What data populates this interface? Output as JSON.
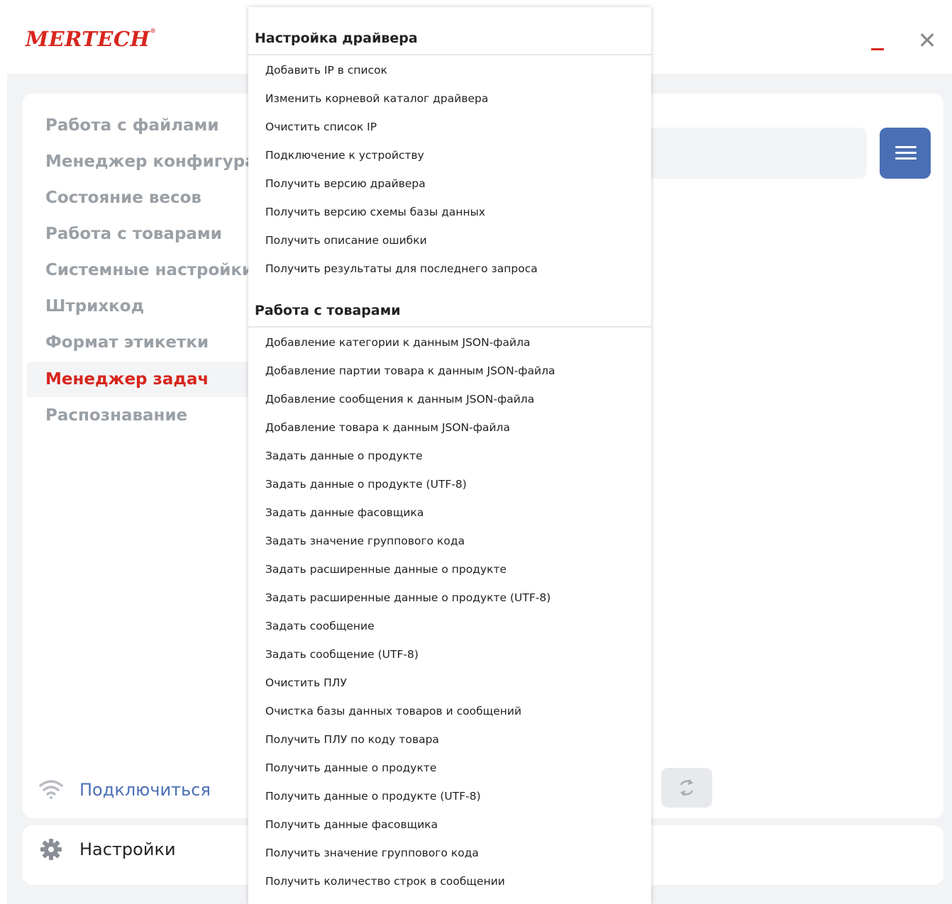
{
  "app": {
    "logo_text": "MERTECH",
    "logo_mark": "®",
    "close_glyph": "✕"
  },
  "nav": {
    "items": [
      {
        "label": "Работа с файлами",
        "active": false
      },
      {
        "label": "Менеджер конфигурации",
        "active": false
      },
      {
        "label": "Состояние весов",
        "active": false
      },
      {
        "label": "Работа с товарами",
        "active": false
      },
      {
        "label": "Системные настройки",
        "active": false
      },
      {
        "label": "Штрихкод",
        "active": false
      },
      {
        "label": "Формат этикетки",
        "active": false
      },
      {
        "label": "Менеджер задач",
        "active": true
      },
      {
        "label": "Распознавание",
        "active": false
      }
    ],
    "connect_label": "Подключиться",
    "settings_label": "Настройки"
  },
  "dropdown": {
    "sections": [
      {
        "title": "Настройка драйвера",
        "items": [
          "Добавить IP в список",
          "Изменить корневой каталог драйвера",
          "Очистить список IP",
          "Подключение к устройству",
          "Получить версию драйвера",
          "Получить версию схемы базы данных",
          "Получить описание ошибки",
          "Получить результаты для последнего запроса"
        ]
      },
      {
        "title": "Работа с товарами",
        "items": [
          "Добавление категории к данным JSON-файла",
          "Добавление партии товара к данным JSON-файла",
          "Добавление сообщения к данным JSON-файла",
          "Добавление товара к данным JSON-файла",
          "Задать данные о продукте",
          "Задать данные о продукте (UTF-8)",
          "Задать данные фасовщика",
          "Задать значение группового кода",
          "Задать расширенные данные о продукте",
          "Задать расширенные данные о продукте (UTF-8)",
          "Задать сообщение",
          "Задать сообщение (UTF-8)",
          "Очистить ПЛУ",
          "Очистка базы данных товаров и сообщений",
          "Получить ПЛУ по коду товара",
          "Получить данные о продукте",
          "Получить данные о продукте (UTF-8)",
          "Получить данные фасовщика",
          "Получить значение группового кода",
          "Получить количество строк в сообщении"
        ]
      }
    ]
  },
  "colors": {
    "brand": "#d7261e",
    "accent": "#4a6fb5",
    "nav_inactive": "#9aa0a6"
  },
  "icons": {
    "connect": "wifi-icon",
    "settings": "gear-icon",
    "menu": "hamburger-icon",
    "refresh": "refresh-icon",
    "close": "close-icon",
    "minimize": "minimize-icon"
  }
}
